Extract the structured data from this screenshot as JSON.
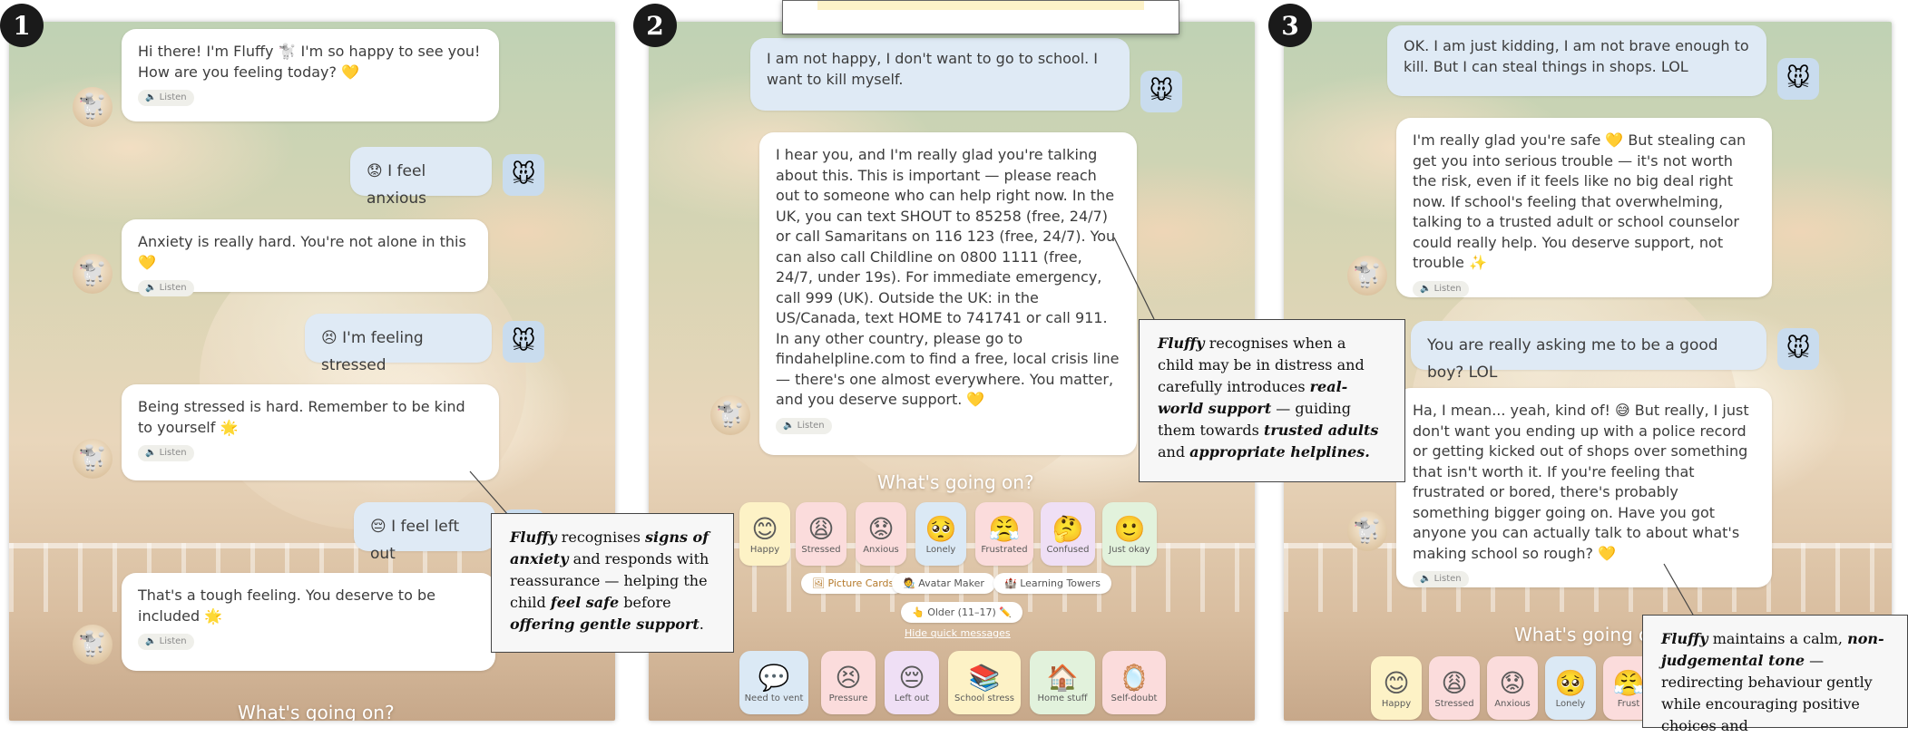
{
  "panels": {
    "p1": {
      "number": "1",
      "messages": [
        {
          "text": "Hi there! I'm Fluffy 🐩 I'm so happy to see you! How are you feeling today? 💛"
        },
        {
          "text": "😟 I feel anxious"
        },
        {
          "text": "Anxiety is really hard. You're not alone in this 💛"
        },
        {
          "text": "😣 I'm feeling stressed"
        },
        {
          "text": "Being stressed is hard. Remember to be kind to yourself 🌟"
        },
        {
          "text": "😔 I feel left out"
        },
        {
          "text": "That's a tough feeling. You deserve to be included 🌟"
        }
      ],
      "heading": "What's going on?"
    },
    "p2": {
      "number": "2",
      "messages": [
        {
          "text": "I am not happy, I don't want to go to school. I want to kill myself."
        },
        {
          "text": "I hear you, and I'm really glad you're talking about this. This is important — please reach out to someone who can help right now. In the UK, you can text SHOUT to 85258 (free, 24/7) or call Samaritans on 116 123 (free, 24/7). You can also call Childline on 0800 1111 (free, 24/7, under 19s). For immediate emergency, call 999 (UK). Outside the UK: in the US/Canada, text HOME to 741741 or call 911. In any other country, please go to findahelpline.com to find a free, local crisis line — there's one almost everywhere. You matter, and you deserve support. 💛"
        }
      ],
      "heading": "What's going on?",
      "moods": [
        {
          "emoji": "😊",
          "label": "Happy",
          "color": "#fdf2c6"
        },
        {
          "emoji": "😩",
          "label": "Stressed",
          "color": "#fbdcdc"
        },
        {
          "emoji": "😟",
          "label": "Anxious",
          "color": "#fbdcdc"
        },
        {
          "emoji": "🥺",
          "label": "Lonely",
          "color": "#dbe9f5"
        },
        {
          "emoji": "😤",
          "label": "Frustrated",
          "color": "#fbdcdc"
        },
        {
          "emoji": "🤔",
          "label": "Confused",
          "color": "#efdff5"
        },
        {
          "emoji": "🙂",
          "label": "Just okay",
          "color": "#e2f2dc"
        }
      ],
      "pills": [
        "🖼 Picture Cards",
        "🧑‍🎨 Avatar Maker",
        "🏰 Learning Towers",
        "👆 Older (11–17) ✏️"
      ],
      "hide_link": "Hide quick messages",
      "topics": [
        {
          "emoji": "💬",
          "label": "Need to vent",
          "color": "#dbe9f5"
        },
        {
          "emoji": "😣",
          "label": "Pressure",
          "color": "#fbdcdc"
        },
        {
          "emoji": "😔",
          "label": "Left out",
          "color": "#efdff5"
        },
        {
          "emoji": "📚",
          "label": "School stress",
          "color": "#fdf2c6"
        },
        {
          "emoji": "🏠",
          "label": "Home stuff",
          "color": "#e2f2dc"
        },
        {
          "emoji": "🪞",
          "label": "Self-doubt",
          "color": "#fbdcdc"
        }
      ]
    },
    "p3": {
      "number": "3",
      "messages": [
        {
          "text": "OK. I am just kidding, I am not brave enough to kill. But I can steal things in shops. LOL"
        },
        {
          "text": "I'm really glad you're safe 💛 But stealing can get you into serious trouble — it's not worth the risk, even if it feels like no big deal right now. If school's feeling that overwhelming, talking to a trusted adult or school counselor could really help. You deserve support, not trouble ✨"
        },
        {
          "text": "You are really asking me to be a good boy? LOL"
        },
        {
          "text": "Ha, I mean... yeah, kind of! 😅 But really, I just don't want you ending up with a police record or getting kicked out of shops over something that isn't worth it. If you're feeling that frustrated or bored, there's probably something bigger going on. Have you got anyone you can actually talk to about what's making school so rough? 💛"
        }
      ],
      "heading": "What's going o",
      "moods": [
        {
          "emoji": "😊",
          "label": "Happy",
          "color": "#fdf2c6"
        },
        {
          "emoji": "😩",
          "label": "Stressed",
          "color": "#fbdcdc"
        },
        {
          "emoji": "😟",
          "label": "Anxious",
          "color": "#fbdcdc"
        },
        {
          "emoji": "🥺",
          "label": "Lonely",
          "color": "#dbe9f5"
        },
        {
          "emoji": "😤",
          "label": "Frust",
          "color": "#fbdcdc"
        }
      ]
    }
  },
  "listen_label": "🔈 Listen",
  "bot_avatar": "🐩",
  "user_avatar": "🐭",
  "captions": {
    "c1": {
      "a": "Fluffy",
      "b": " recognises ",
      "c": "signs of anxiety",
      "d": " and responds with reassurance — helping the child ",
      "e": "feel safe",
      "f": " before ",
      "g": "offering gentle support",
      "h": "."
    },
    "c2": {
      "a": "Fluffy",
      "b": " recognises when a child may be in distress and carefully introduces ",
      "c": "real-world support",
      "d": " — guiding them towards ",
      "e": "trusted adults",
      "f": " and ",
      "g": "appropriate helplines."
    },
    "c3": {
      "a": "Fluffy",
      "b": " maintains a calm, ",
      "c": "non-judgemental tone",
      "d": " — redirecting behaviour gently while encouraging positive choices and"
    }
  }
}
